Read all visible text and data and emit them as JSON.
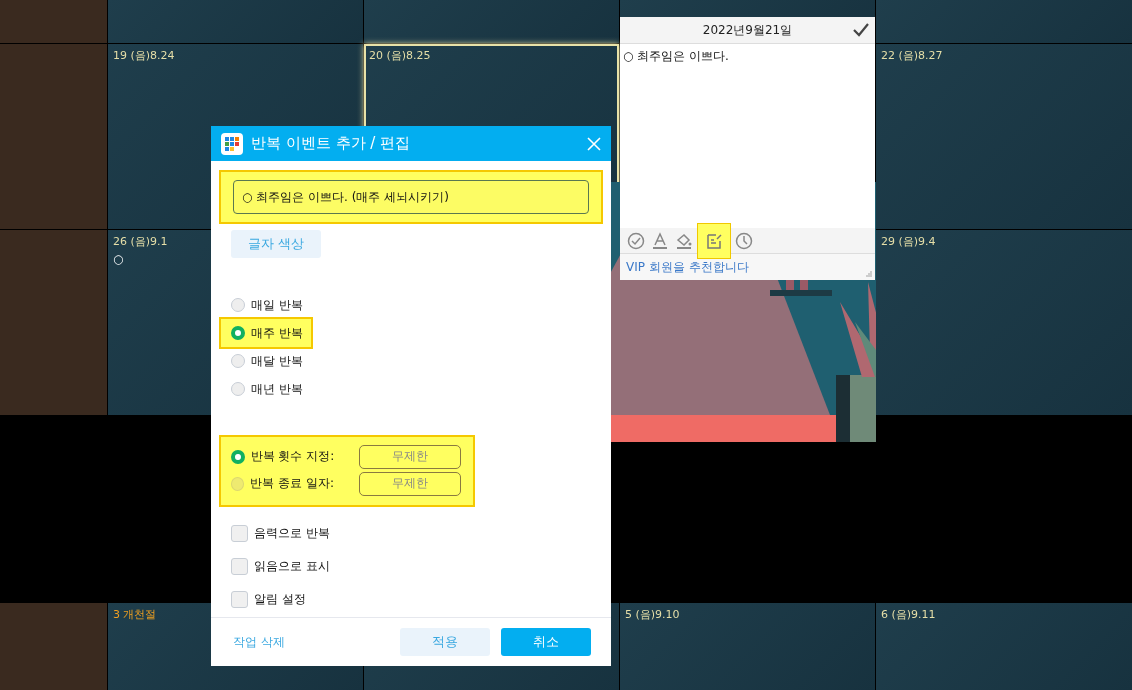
{
  "calendar": {
    "weeks": [
      {
        "cells": [
          {},
          {},
          {},
          {},
          {}
        ]
      },
      {
        "cells": [
          {},
          {
            "label": "19 (음)8.24",
            "selected": false
          },
          {
            "label": "20 (음)8.25",
            "selected": true
          },
          null,
          {
            "label": "22 (음)8.27",
            "selected": false
          }
        ]
      },
      {
        "cells": [
          {},
          {
            "label": "26 (음)9.1",
            "selected": false,
            "events": [
              "○"
            ]
          },
          null,
          null,
          {
            "label": "29 (음)9.4",
            "selected": false
          }
        ]
      },
      {
        "cells": [
          {},
          {
            "label": "3 개천절",
            "selected": false,
            "holiday": true
          },
          {},
          {
            "label": "5 (음)9.10",
            "selected": false
          },
          {
            "label": "6 (음)9.11",
            "selected": false
          }
        ]
      }
    ]
  },
  "day_popup": {
    "date": "2022년9월21일",
    "note": "○ 최주임은 이쁘다.",
    "tools": [
      {
        "kind": "check",
        "highlighted": false
      },
      {
        "kind": "text-color",
        "highlighted": false
      },
      {
        "kind": "fill",
        "highlighted": false
      },
      {
        "kind": "memo",
        "highlighted": true
      },
      {
        "kind": "clock",
        "highlighted": false
      }
    ],
    "link": "VIP 회원을 추천합니다"
  },
  "dialog": {
    "title": "반복 이벤트 추가 / 편집",
    "event_text": "○ 최주임은 이쁘다. (매주 세뇌시키기)",
    "event_highlighted": true,
    "text_color_button": "글자 색상",
    "repeat_options": [
      {
        "label": "매일 반복",
        "selected": false,
        "highlighted": false
      },
      {
        "label": "매주 반복",
        "selected": true,
        "highlighted": true
      },
      {
        "label": "매달 반복",
        "selected": false,
        "highlighted": false
      },
      {
        "label": "매년 반복",
        "selected": false,
        "highlighted": false
      }
    ],
    "limits_highlighted": true,
    "limit_options": [
      {
        "label": "반복 횟수 지정:",
        "selected": true,
        "value": "무제한"
      },
      {
        "label": "반복 종료 일자:",
        "selected": false,
        "value": "무제한"
      }
    ],
    "checkboxes": [
      {
        "label": "음력으로 반복",
        "checked": false
      },
      {
        "label": "읽음으로 표시",
        "checked": false
      },
      {
        "label": "알림 설정",
        "checked": false
      }
    ],
    "delete_link": "작업 삭제",
    "apply_button": "적용",
    "cancel_button": "취소"
  }
}
